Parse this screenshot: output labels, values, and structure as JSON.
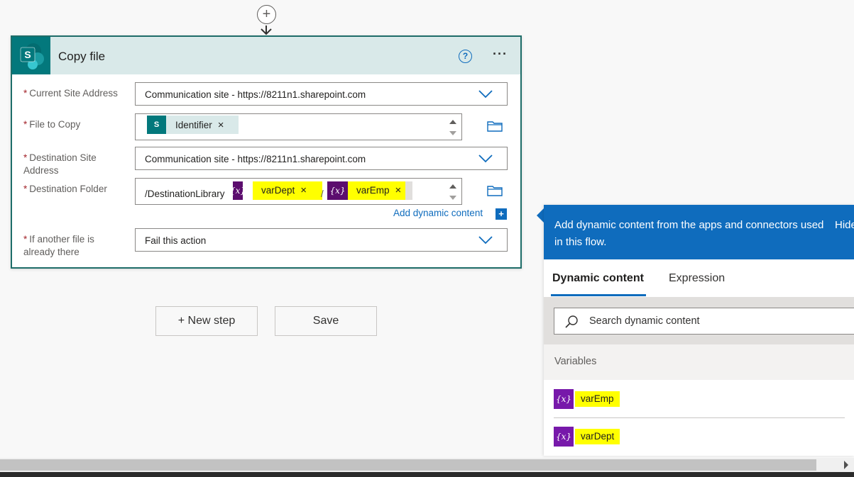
{
  "card": {
    "title": "Copy file",
    "help_symbol": "?",
    "more_symbol": "···",
    "brand_color": "#03787c"
  },
  "fields": {
    "site_label": "Current Site Address",
    "site_value": "Communication site - https://8211n1.sharepoint.com",
    "file_label": "File to Copy",
    "file_token": "Identifier",
    "dest_site_label_1": "Destination Site",
    "dest_site_label_2": "Address",
    "dest_site_value": "Communication site - https://8211n1.sharepoint.com",
    "dest_folder_label": "Destination Folder",
    "dest_folder_prefix": "/DestinationLibrary",
    "dest_folder_sep": "/",
    "dest_token_1": "varDept",
    "dest_token_2": "varEmp",
    "if_exists_label_1": "If another file is",
    "if_exists_label_2": "already there",
    "if_exists_value": "Fail this action",
    "required_mark": "*",
    "remove_symbol": "×",
    "var_icon_text": "{x}",
    "sp_icon_text": "S"
  },
  "add_dynamic": {
    "label": "Add dynamic content",
    "plus": "+"
  },
  "buttons": {
    "new_step": "+ New step",
    "save": "Save"
  },
  "dynamic_panel": {
    "header_text": "Add dynamic content from the apps and connectors used in this flow.",
    "hide_label": "Hide",
    "tab_dynamic": "Dynamic content",
    "tab_expression": "Expression",
    "search_placeholder": "Search dynamic content",
    "section_title": "Variables",
    "items": [
      {
        "icon": "{x}",
        "name": "varEmp"
      },
      {
        "icon": "{x}",
        "name": "varDept"
      }
    ]
  },
  "colors": {
    "accent": "#0f6cbd",
    "variable": "#7719aa",
    "highlight": "#ffff00",
    "card_border": "#1e6d69"
  }
}
